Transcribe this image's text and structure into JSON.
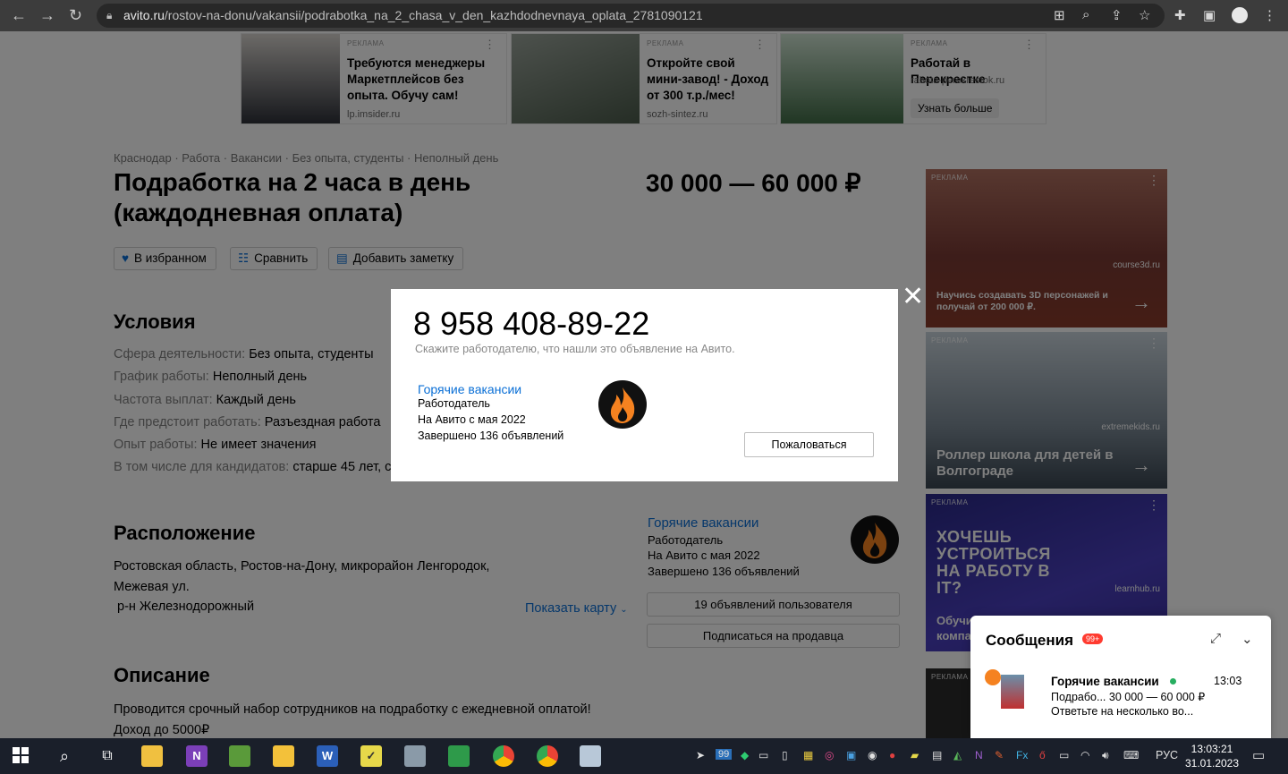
{
  "browser": {
    "url_host": "avito.ru",
    "url_path": "/rostov-na-donu/vakansii/podrabotka_na_2_chasa_v_den_kazhdodnevnaya_oplata_2781090121"
  },
  "top_ads": [
    {
      "tag": "РЕКЛАМА",
      "text": "Требуются менеджеры Маркетплейсов без опыта. Обучу сам!",
      "source": "lp.imsider.ru"
    },
    {
      "tag": "РЕКЛАМА",
      "text": "Откройте свой мини-завод! - Доход от 300 т.р./мес!",
      "source": "sozh-sintez.ru"
    },
    {
      "tag": "РЕКЛАМА",
      "text": "Работай в Перекрестке",
      "source": "rabota-perekrestok.ru",
      "button": "Узнать больше"
    }
  ],
  "breadcrumb": "Краснодар · Работа · Вакансии · Без опыта, студенты · Неполный день",
  "title": "Подработка на 2 часа в день (каждодневная оплата)",
  "price": "30 000 — 60 000 ₽",
  "actions": {
    "favorite": "В избранном",
    "compare": "Сравнить",
    "note": "Добавить заметку"
  },
  "conditions": {
    "heading": "Условия",
    "rows": [
      {
        "k": "Сфера деятельности:",
        "v": "Без опыта, студенты"
      },
      {
        "k": "График работы:",
        "v": "Неполный день"
      },
      {
        "k": "Частота выплат:",
        "v": "Каждый день"
      },
      {
        "k": "Где предстоит работать:",
        "v": "Разъездная работа"
      },
      {
        "k": "Опыт работы:",
        "v": "Не имеет значения"
      },
      {
        "k": "В том числе для кандидатов:",
        "v": "старше 45 лет, с"
      }
    ]
  },
  "location": {
    "heading": "Расположение",
    "line1": "Ростовская область, Ростов-на-Дону, микрорайон Ленгородок,",
    "line2": "Межевая ул.",
    "line3": "р-н Железнодорожный",
    "show_map": "Показать карту"
  },
  "description": {
    "heading": "Описание",
    "line1": "Проводится срочный набор сотрудников на подработку с ежедневной оплатой!",
    "line2": "Доход до 5000₽"
  },
  "seller": {
    "name": "Горячие вакансии",
    "role": "Работодатель",
    "since": "На Авито с мая 2022",
    "completed": "Завершено 136 объявлений",
    "listings_button": "19 объявлений пользователя",
    "subscribe_button": "Подписаться на продавца"
  },
  "right_ads": [
    {
      "tag": "РЕКЛАМА",
      "text": "Научись создавать 3D персонажей и получай от 200 000 ₽.",
      "source": "course3d.ru"
    },
    {
      "tag": "РЕКЛАМА",
      "text": "Роллер школа для детей в Волгограде",
      "source": "extremekids.ru"
    },
    {
      "tag": "РЕКЛАМА",
      "text": "ХОЧЕШЬ УСТРОИТЬСЯ НА РАБОТУ В IT?",
      "source": "learnhub.ru",
      "text2": "Обучи компа"
    },
    {
      "tag": "РЕКЛАМА"
    }
  ],
  "modal": {
    "phone": "8 958 408-89-22",
    "hint": "Скажите работодателю, что нашли это объявление на Авито.",
    "seller_name": "Горячие вакансии",
    "role": "Работодатель",
    "since": "На Авито с мая 2022",
    "completed": "Завершено 136 объявлений",
    "report_button": "Пожаловаться"
  },
  "messages": {
    "title": "Сообщения",
    "badge": "99+",
    "chat_name": "Горячие вакансии",
    "chat_time": "13:03",
    "chat_line1": "Подрабо... 30 000 — 60 000 ₽",
    "chat_line2": "Ответьте на несколько во..."
  },
  "taskbar": {
    "tray_badge": "99",
    "lang": "РУС",
    "time": "13:03:21",
    "date": "31.01.2023"
  }
}
